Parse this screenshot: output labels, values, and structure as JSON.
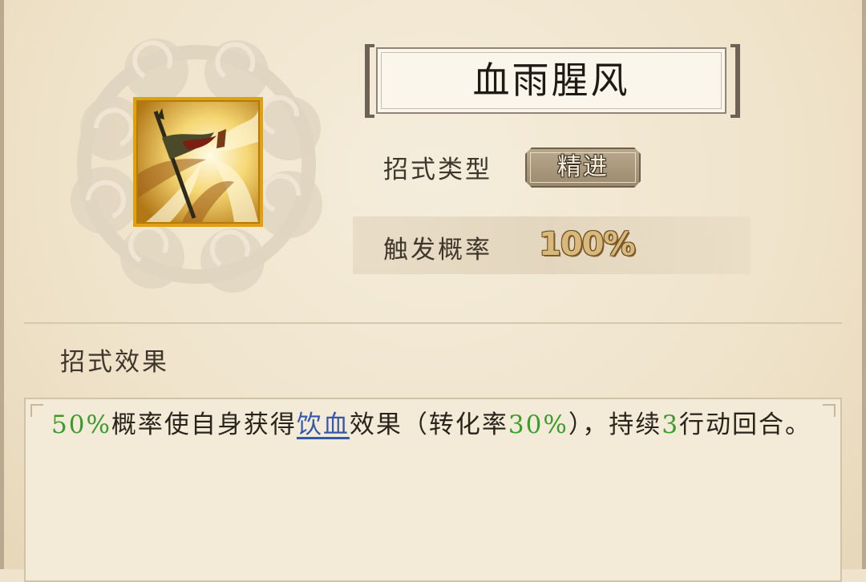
{
  "skill": {
    "name": "血雨腥风",
    "icon": "flag-spear-icon",
    "type_label": "招式类型",
    "type_value": "精进",
    "trigger_label": "触发概率",
    "trigger_value": "100%"
  },
  "effect": {
    "heading": "招式效果",
    "p1": "50%",
    "t1": "概率使自身获得",
    "keyword": "饮血",
    "t2": "效果（转化率",
    "p2": "30%",
    "t3": "），持续",
    "n3": "3",
    "t4": "行动回合。"
  },
  "colors": {
    "highlight_number": "#3b9c2a",
    "keyword_link": "#3558a8",
    "icon_border": "#e0a014"
  }
}
